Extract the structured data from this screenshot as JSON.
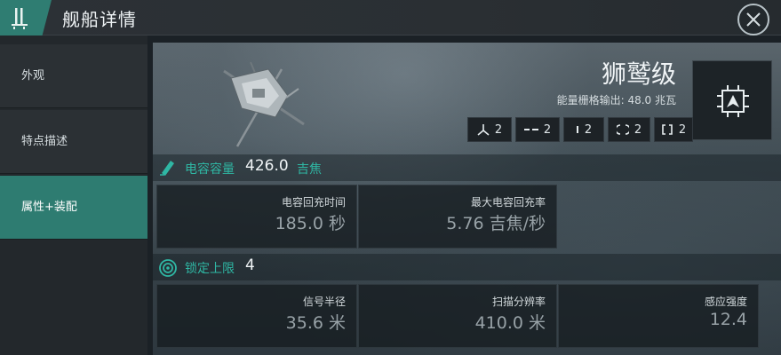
{
  "header": {
    "title": "舰船详情"
  },
  "sidebar": {
    "items": [
      {
        "label": "外观"
      },
      {
        "label": "特点描述"
      },
      {
        "label": "属性+装配"
      }
    ],
    "active_index": 2
  },
  "ship": {
    "name": "狮鹫级",
    "grid_output": "能量栅格输出: 48.0 兆瓦"
  },
  "slots": [
    {
      "icon": "turret-hardpoint-icon",
      "count": "2"
    },
    {
      "icon": "launcher-hardpoint-icon",
      "count": "2"
    },
    {
      "icon": "high-slot-icon",
      "count": "2"
    },
    {
      "icon": "mid-slot-icon",
      "count": "2"
    },
    {
      "icon": "low-slot-icon",
      "count": "2"
    }
  ],
  "capacitor": {
    "label": "电容容量",
    "value": "426.0",
    "unit": "吉焦",
    "stats": [
      {
        "label": "电容回充时间",
        "value": "185.0 秒"
      },
      {
        "label": "最大电容回充率",
        "value": "5.76 吉焦/秒"
      }
    ]
  },
  "targeting": {
    "label": "锁定上限",
    "value": "4",
    "stats": [
      {
        "label": "信号半径",
        "value": "35.6 米"
      },
      {
        "label": "扫描分辨率",
        "value": "410.0 米"
      },
      {
        "label": "感应强度",
        "value": "12.4"
      }
    ]
  },
  "colors": {
    "accent": "#2e7c71",
    "accent_text": "#2fb7a4"
  }
}
